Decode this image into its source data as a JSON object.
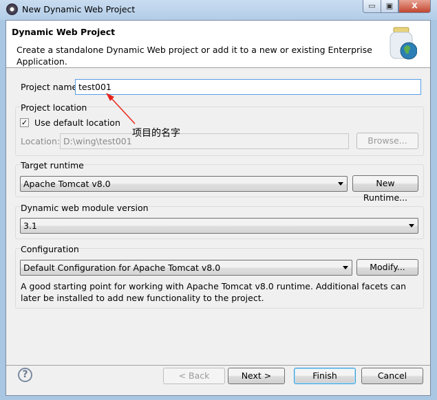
{
  "window": {
    "title": "New Dynamic Web Project",
    "minimize": "▭",
    "maximize": "▣",
    "close": "X"
  },
  "header": {
    "title": "Dynamic Web Project",
    "description": "Create a standalone Dynamic Web project or add it to a new or existing Enterprise Application.",
    "icon": "jar-globe-icon"
  },
  "project_name": {
    "label": "Project name:",
    "value": "test001"
  },
  "location": {
    "group_label": "Project location",
    "use_default_label": "Use default location",
    "use_default_checked": true,
    "location_label": "Location:",
    "location_value": "D:\\wing\\test001",
    "browse": "Browse..."
  },
  "runtime": {
    "group_label": "Target runtime",
    "selected": "Apache Tomcat v8.0",
    "new_runtime": "New Runtime..."
  },
  "module": {
    "group_label": "Dynamic web module version",
    "selected": "3.1"
  },
  "configuration": {
    "group_label": "Configuration",
    "selected": "Default Configuration for Apache Tomcat v8.0",
    "modify": "Modify...",
    "description": "A good starting point for working with Apache Tomcat v8.0 runtime. Additional facets can later be installed to add new functionality to the project."
  },
  "annotation": {
    "text": "项目的名字",
    "color": "#e8241c"
  },
  "footer": {
    "help": "?",
    "back": "< Back",
    "next": "Next >",
    "finish": "Finish",
    "cancel": "Cancel"
  }
}
